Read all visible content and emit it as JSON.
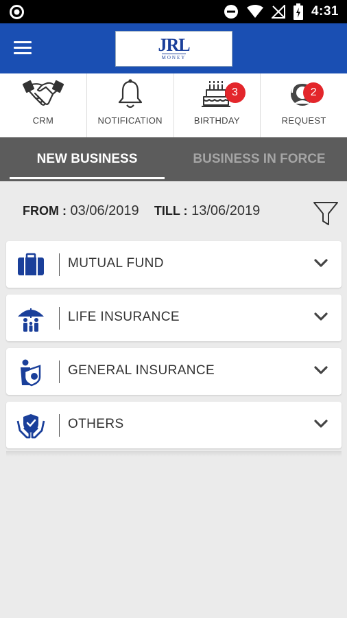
{
  "status_bar": {
    "time": "4:31"
  },
  "app_bar": {
    "logo_main": "JRL",
    "logo_sub": "MONEY"
  },
  "quick_actions": [
    {
      "label": "CRM"
    },
    {
      "label": "NOTIFICATION"
    },
    {
      "label": "BIRTHDAY",
      "badge": "3"
    },
    {
      "label": "REQUEST",
      "badge": "2"
    }
  ],
  "tabs": [
    {
      "label": "NEW BUSINESS",
      "active": true
    },
    {
      "label": "BUSINESS IN FORCE",
      "active": false
    }
  ],
  "date_filter": {
    "from_label": "FROM :",
    "from_value": "03/06/2019",
    "till_label": "TILL :",
    "till_value": "13/06/2019"
  },
  "categories": [
    {
      "label": "MUTUAL FUND",
      "icon": "briefcase-icon"
    },
    {
      "label": "LIFE INSURANCE",
      "icon": "family-umbrella-icon"
    },
    {
      "label": "GENERAL INSURANCE",
      "icon": "person-shield-icon"
    },
    {
      "label": "OTHERS",
      "icon": "hands-shield-icon"
    }
  ],
  "colors": {
    "app_bar": "#1a4fb3",
    "tab_bar": "#5c5c5c",
    "badge": "#e3262b",
    "icon_blue": "#1a3f9a",
    "background": "#ebebeb"
  }
}
